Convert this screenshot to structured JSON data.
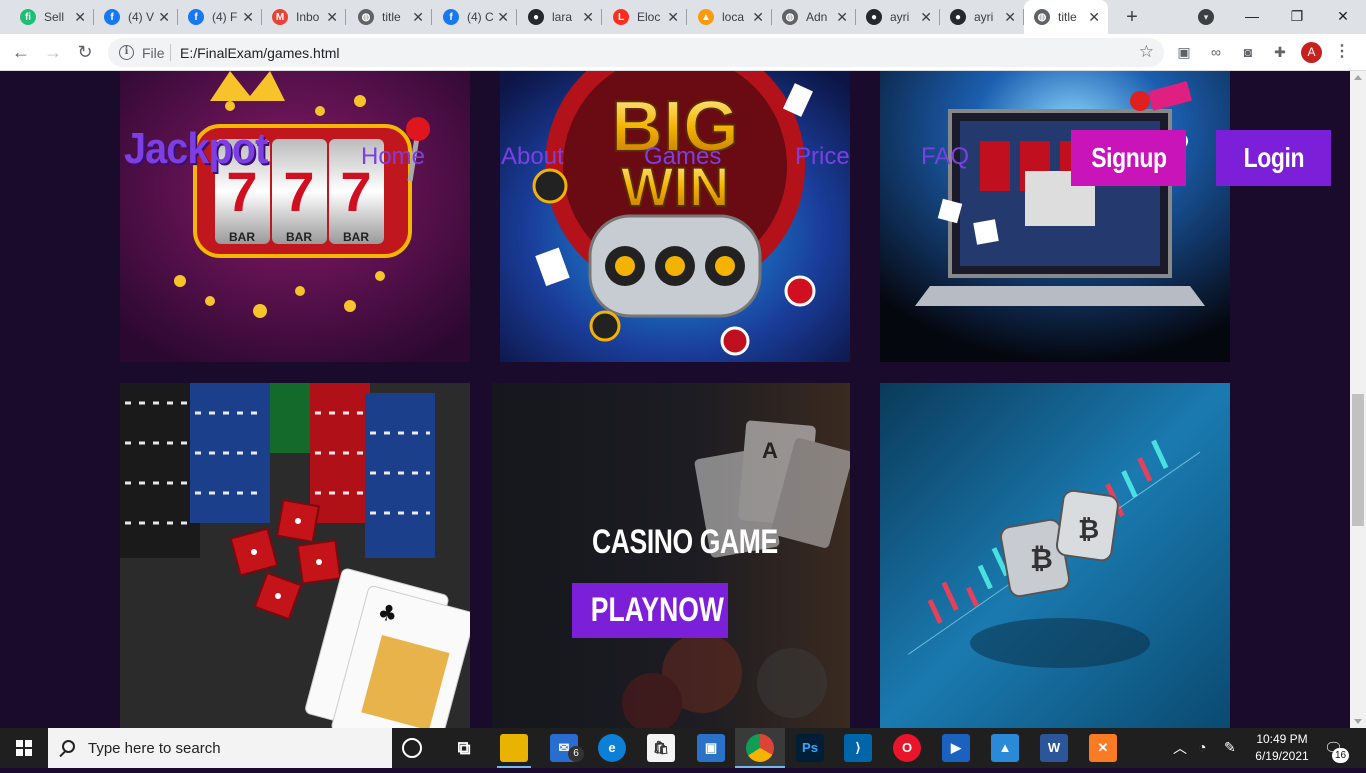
{
  "browser": {
    "tabs": [
      {
        "title": "Sell",
        "icon": "fiverr-icon",
        "color": "#1dbf73",
        "glyph": "fi"
      },
      {
        "title": "(4) V",
        "icon": "facebook-icon",
        "color": "#1877f2",
        "glyph": "f"
      },
      {
        "title": "(4) F",
        "icon": "facebook-icon",
        "color": "#1877f2",
        "glyph": "f"
      },
      {
        "title": "Inbo",
        "icon": "gmail-icon",
        "color": "#ea4335",
        "glyph": "M"
      },
      {
        "title": "title",
        "icon": "globe-icon",
        "color": "#5f6368",
        "glyph": "◍"
      },
      {
        "title": "(4) C",
        "icon": "facebook-icon",
        "color": "#1877f2",
        "glyph": "f"
      },
      {
        "title": "lara",
        "icon": "github-icon",
        "color": "#24292e",
        "glyph": "●"
      },
      {
        "title": "Eloc",
        "icon": "laravel-icon",
        "color": "#ff2d20",
        "glyph": "L"
      },
      {
        "title": "loca",
        "icon": "phpmyadmin-icon",
        "color": "#f89c0e",
        "glyph": "▲"
      },
      {
        "title": "Adn",
        "icon": "globe-icon",
        "color": "#5f6368",
        "glyph": "◍"
      },
      {
        "title": "ayri",
        "icon": "github-icon",
        "color": "#24292e",
        "glyph": "●"
      },
      {
        "title": "ayri",
        "icon": "github-icon",
        "color": "#24292e",
        "glyph": "●"
      },
      {
        "title": "title",
        "icon": "globe-icon",
        "color": "#5f6368",
        "glyph": "◍",
        "active": true
      }
    ],
    "close_glyph": "✕",
    "new_tab_glyph": "+",
    "controls": {
      "minimize": "—",
      "maximize": "❐",
      "close": "✕"
    },
    "address": {
      "scheme_label": "File",
      "url": "E:/FinalExam/games.html"
    },
    "avatar_letter": "A"
  },
  "page": {
    "brand": "Jackpot",
    "nav": [
      {
        "label": "Home"
      },
      {
        "label": "About"
      },
      {
        "label": "Games"
      },
      {
        "label": "Price"
      },
      {
        "label": "FAQ"
      }
    ],
    "signup_label": "Signup",
    "login_label": "Login",
    "casino_title": "CASINO GAME",
    "play_label": "PLAYNOW",
    "accent": "#7c1fd9",
    "signup_color": "#c814b8",
    "slot_machine_label": "BAR",
    "bigwin_line1": "BIG",
    "bigwin_line2": "WIN",
    "cards": [
      {
        "name": "slot-machine-777-image"
      },
      {
        "name": "big-win-image"
      },
      {
        "name": "online-casino-laptop-image"
      },
      {
        "name": "poker-chips-dice-image"
      },
      {
        "name": "casino-game-card"
      },
      {
        "name": "crypto-dice-chart-image"
      }
    ]
  },
  "taskbar": {
    "search_placeholder": "Type here to search",
    "mail_badge": "6",
    "time": "10:49 PM",
    "date": "6/19/2021",
    "notification_count": "16",
    "apps": [
      {
        "name": "cortana-icon"
      },
      {
        "name": "task-view-icon"
      },
      {
        "name": "file-explorer-icon"
      },
      {
        "name": "mail-icon"
      },
      {
        "name": "edge-icon"
      },
      {
        "name": "store-icon"
      },
      {
        "name": "app-icon"
      },
      {
        "name": "chrome-icon"
      },
      {
        "name": "photoshop-icon",
        "text": "Ps"
      },
      {
        "name": "vscode-icon"
      },
      {
        "name": "opera-icon"
      },
      {
        "name": "media-player-icon"
      },
      {
        "name": "photos-icon"
      },
      {
        "name": "word-icon",
        "text": "W"
      },
      {
        "name": "xampp-icon"
      }
    ]
  }
}
